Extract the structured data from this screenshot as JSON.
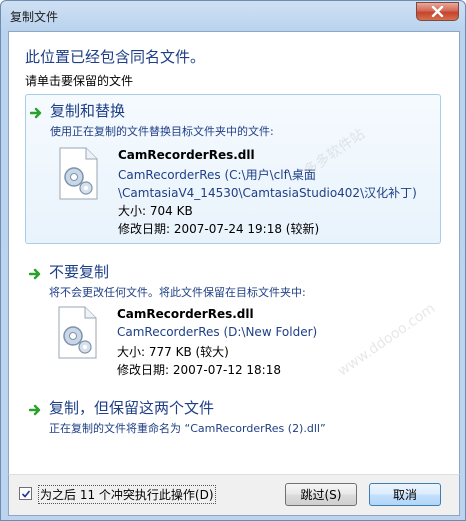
{
  "window": {
    "title": "复制文件"
  },
  "main": {
    "heading": "此位置已经包含同名文件。",
    "subheading": "请单击要保留的文件"
  },
  "options": {
    "replace": {
      "title": "复制和替换",
      "desc": "使用正在复制的文件替换目标文件夹中的文件:",
      "file": {
        "name": "CamRecorderRes.dll",
        "path_line1": "CamRecorderRes (C:\\用户\\clf\\桌面",
        "path_line2": "\\CamtasiaV4_14530\\CamtasiaStudio402\\汉化补丁)",
        "size": "大小: 704 KB",
        "modified": "修改日期: 2007-07-24 19:18 (较新)"
      }
    },
    "skip": {
      "title": "不要复制",
      "desc": "将不会更改任何文件。将此文件保留在目标文件夹中:",
      "file": {
        "name": "CamRecorderRes.dll",
        "path_line1": "CamRecorderRes (D:\\New Folder)",
        "size": "大小: 777 KB (较大)",
        "modified": "修改日期: 2007-07-12 18:18"
      }
    },
    "keep_both": {
      "title": "复制，但保留这两个文件",
      "desc": "正在复制的文件将重命名为 “CamRecorderRes (2).dll”"
    }
  },
  "footer": {
    "checkbox_label": "为之后 11 个冲突执行此操作(D)",
    "checkbox_checked": true,
    "skip_button": "跳过(S)",
    "cancel_button": "取消"
  },
  "colors": {
    "link_blue": "#1e3f86",
    "green_arrow": "#2aa12a"
  }
}
